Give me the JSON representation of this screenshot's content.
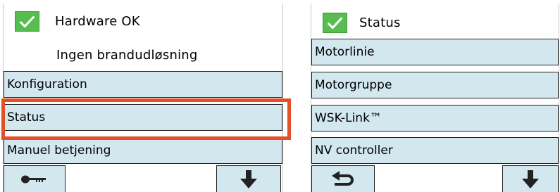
{
  "left_panel": {
    "status_header": "Hardware OK",
    "sub_status": "Ingen brandudløsning",
    "menu": [
      {
        "label": "Konfiguration"
      },
      {
        "label": "Status"
      },
      {
        "label": "Manuel betjening"
      }
    ],
    "icons": {
      "check": "check-icon",
      "left_nav": "key-icon",
      "right_nav": "arrow-down-icon"
    }
  },
  "right_panel": {
    "header": "Status",
    "menu": [
      {
        "label": "Motorlinie"
      },
      {
        "label": "Motorgruppe"
      },
      {
        "label": "WSK-Link™"
      },
      {
        "label": "NV controller"
      }
    ],
    "icons": {
      "check": "check-icon",
      "left_nav": "return-arrow-icon",
      "right_nav": "arrow-down-icon"
    }
  },
  "colors": {
    "button_fill": "#d3e7ef",
    "check_green": "#58bd4f",
    "highlight": "#e15027"
  }
}
